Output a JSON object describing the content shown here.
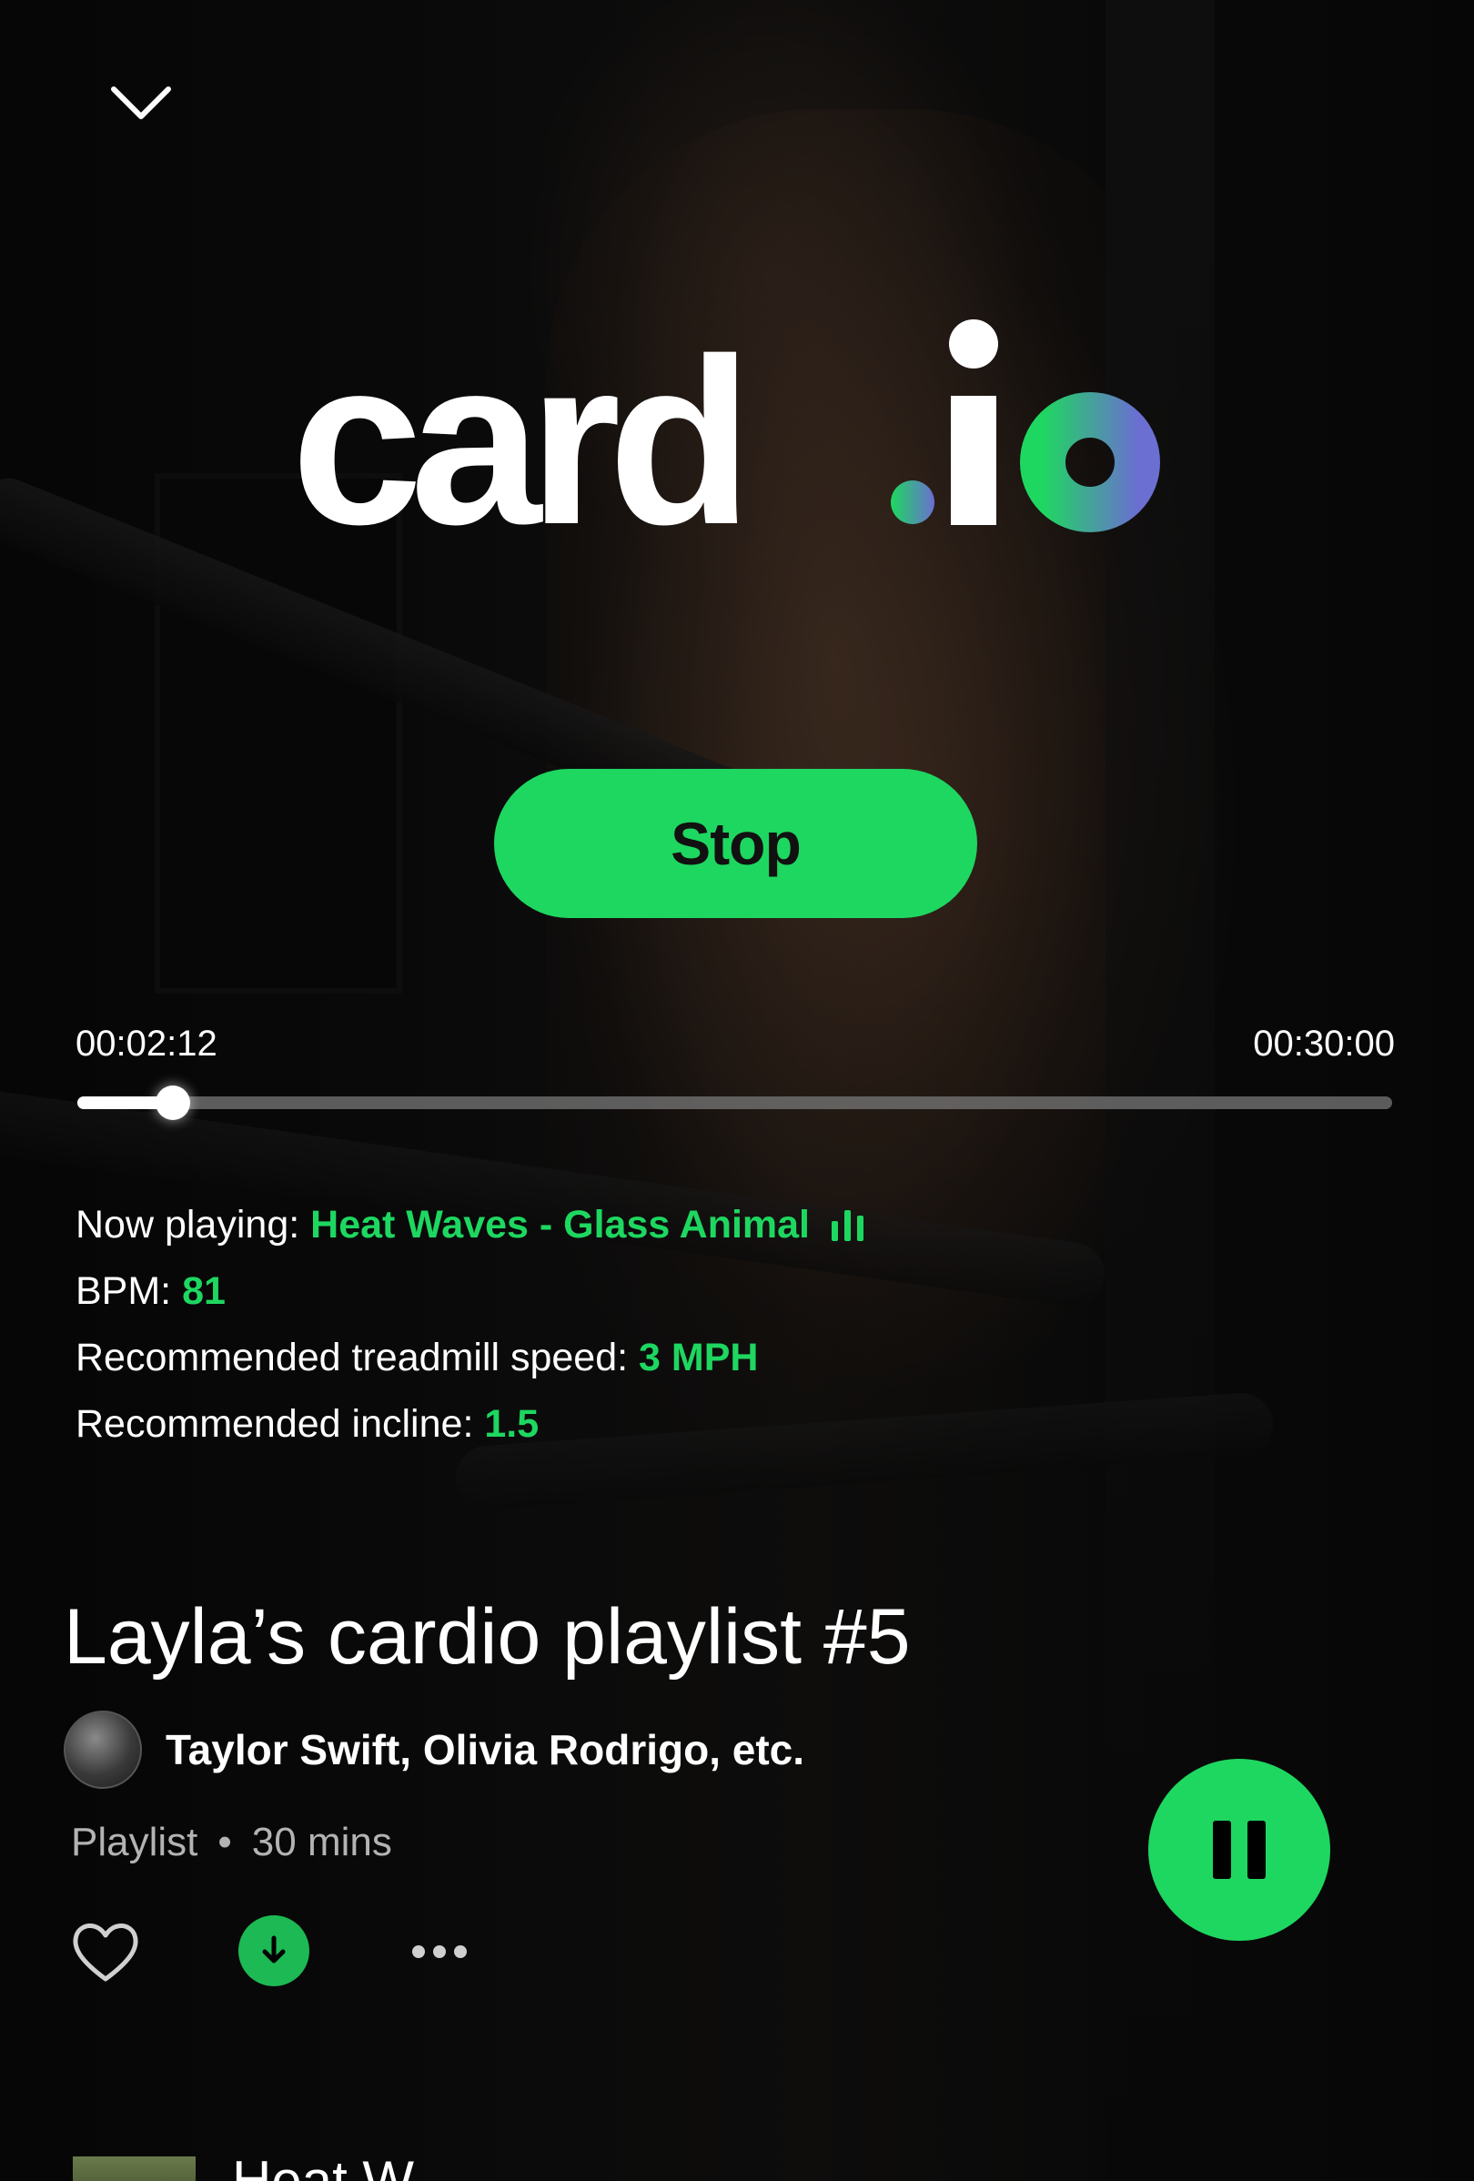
{
  "brand": {
    "name_main": "card",
    "name_dot": ".",
    "name_accent": "io"
  },
  "player": {
    "stop_label": "Stop",
    "elapsed": "00:02:12",
    "total": "00:30:00",
    "progress_fraction": 0.073
  },
  "now_playing": {
    "label": "Now playing:",
    "value": "Heat Waves - Glass Animal",
    "icon": "equalizer-icon"
  },
  "bpm": {
    "label": "BPM:",
    "value": "81"
  },
  "speed": {
    "label": "Recommended treadmill speed:",
    "value": "3 MPH"
  },
  "incline": {
    "label": "Recommended incline:",
    "value": "1.5"
  },
  "playlist": {
    "title": "Layla’s cardio playlist #5",
    "artists": "Taylor Swift, Olivia Rodrigo, etc.",
    "type": "Playlist",
    "separator": "•",
    "duration": "30 mins"
  },
  "next_track": {
    "title": "Heat W"
  },
  "colors": {
    "accent_green": "#1ed760",
    "logo_gradient_start": "#1ed760",
    "logo_gradient_end": "#6a6fd1"
  }
}
